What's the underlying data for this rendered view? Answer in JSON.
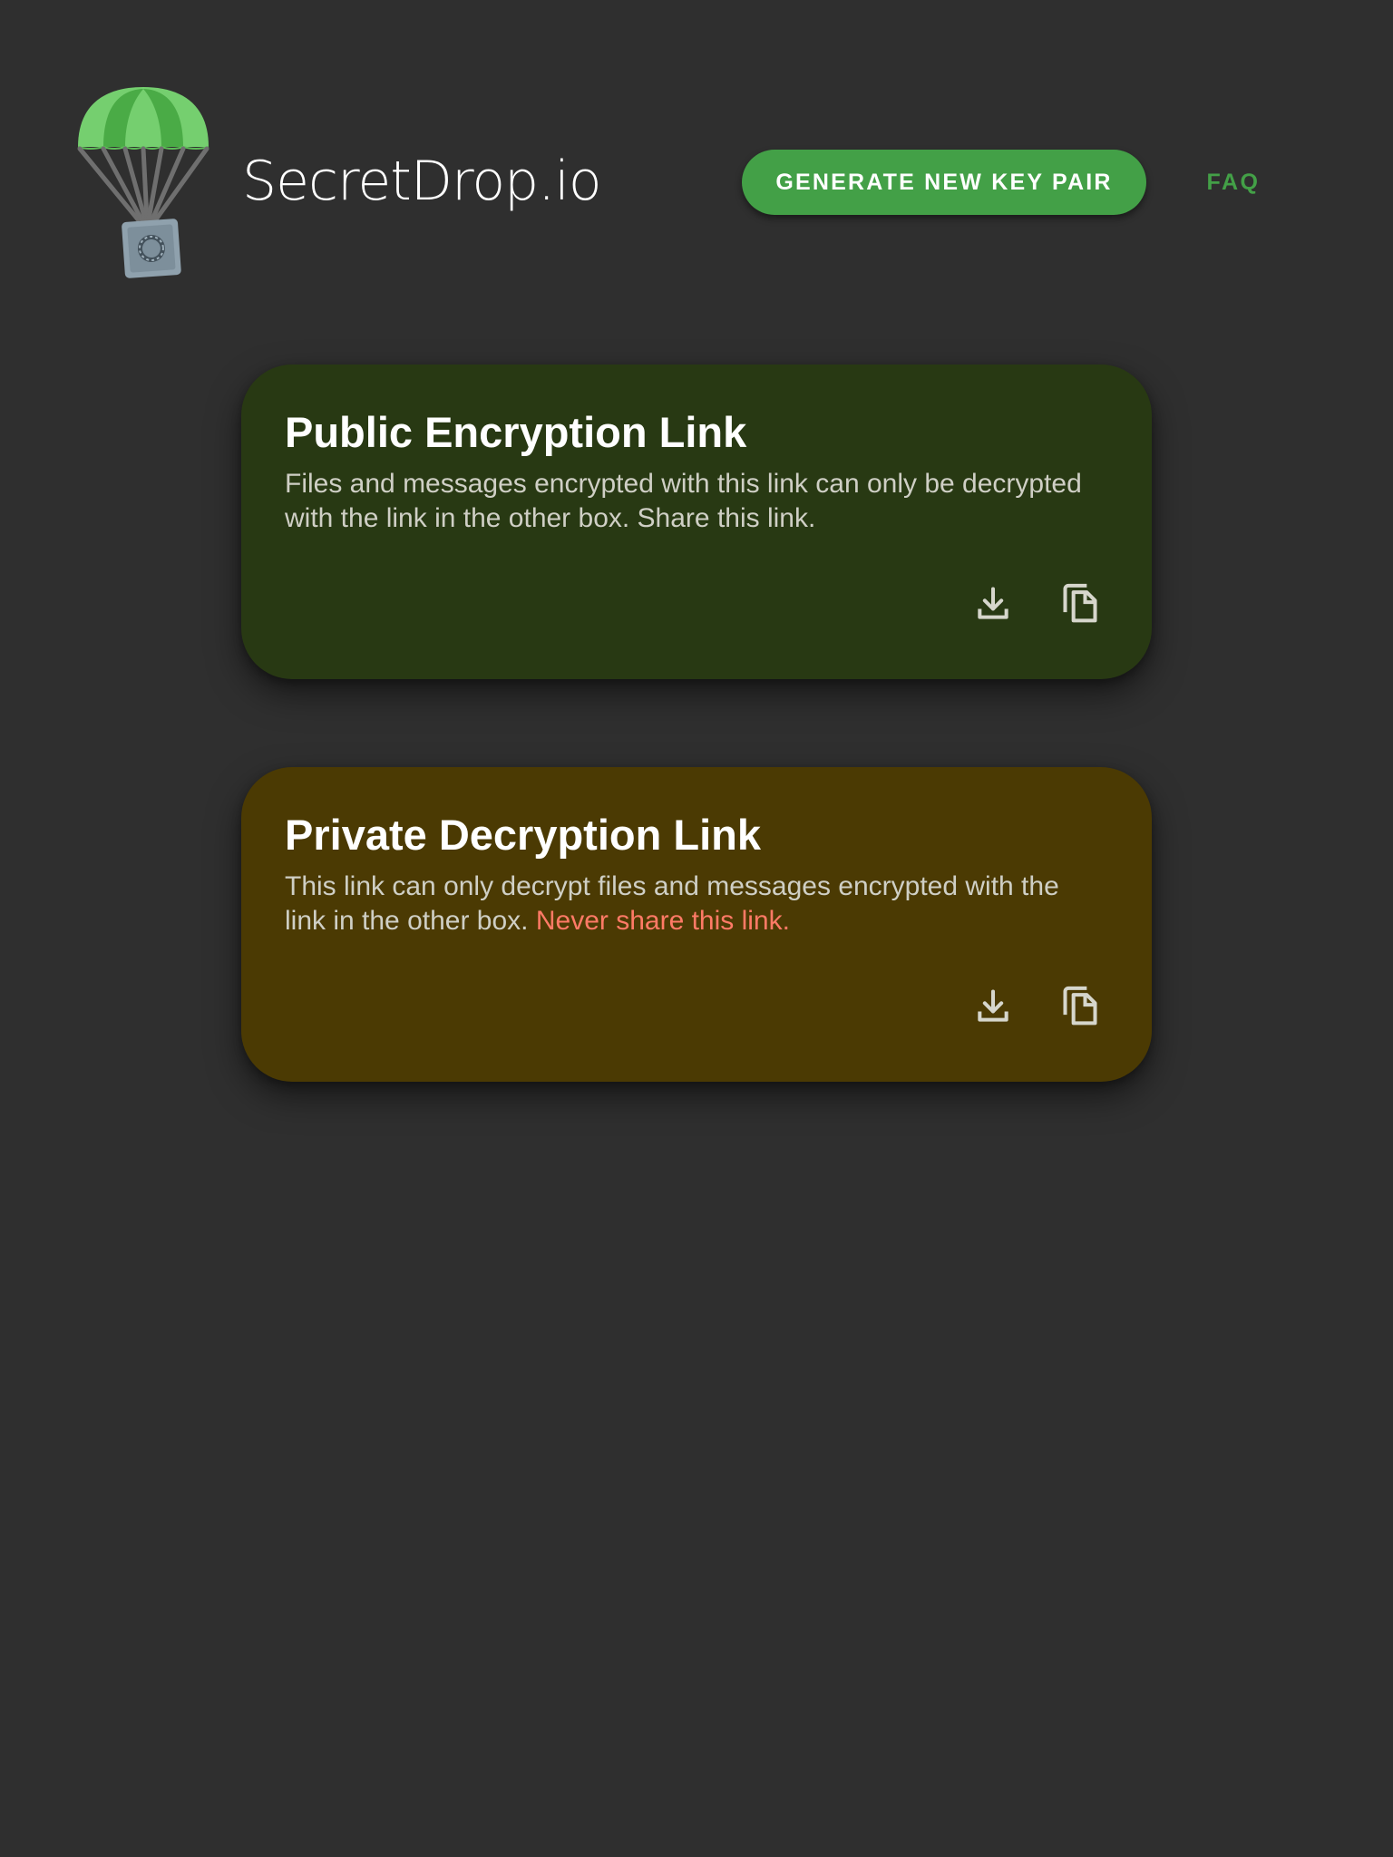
{
  "header": {
    "app_title": "SecretDrop.io",
    "generate_button_label": "GENERATE NEW KEY PAIR",
    "faq_label": "FAQ"
  },
  "cards": [
    {
      "title": "Public Encryption Link",
      "description": "Files and messages encrypted with this link can only be decrypted with the link in the other box. Share this link.",
      "actions": [
        "download-icon",
        "copy-icon"
      ]
    },
    {
      "title": "Private Decryption Link",
      "description": "This link can only decrypt files and messages encrypted with the link in the other box.",
      "warning": "Never share this link.",
      "actions": [
        "download-icon",
        "copy-icon"
      ]
    }
  ],
  "colors": {
    "background": "#2f2f2f",
    "accent": "#43a047",
    "public_card": "#283913",
    "private_card": "#4b3a03",
    "warning_text": "#ff7a66"
  },
  "icons": {
    "logo": "parachute-safe-logo"
  }
}
